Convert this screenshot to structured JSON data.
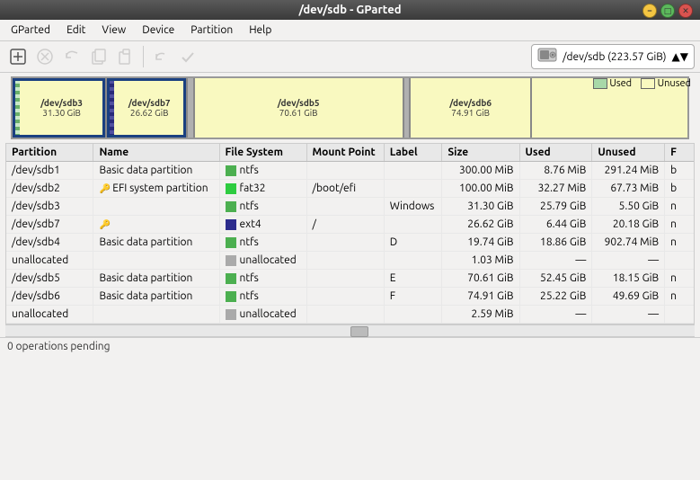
{
  "window": {
    "title": "/dev/sdb - GParted"
  },
  "menubar": {
    "items": [
      "GParted",
      "Edit",
      "View",
      "Device",
      "Partition",
      "Help"
    ]
  },
  "toolbar": {
    "buttons": [
      {
        "name": "new-partition",
        "icon": "➕",
        "disabled": false
      },
      {
        "name": "delete-partition",
        "icon": "🚫",
        "disabled": true
      },
      {
        "name": "resize-partition",
        "icon": "↔",
        "disabled": true
      },
      {
        "name": "copy-partition",
        "icon": "📋",
        "disabled": true
      },
      {
        "name": "paste-partition",
        "icon": "📄",
        "disabled": true
      },
      {
        "name": "undo",
        "icon": "↩",
        "disabled": true
      },
      {
        "name": "apply",
        "icon": "✔",
        "disabled": true
      }
    ],
    "device": {
      "icon": "💾",
      "label": "/dev/sdb  (223.57 GiB)"
    }
  },
  "disk_visual": {
    "partitions": [
      {
        "id": "sdb3",
        "label": "/dev/sdb3",
        "size": "31.30 GiB",
        "width_pct": 14,
        "color": "yellow-ntfs",
        "selected": false,
        "stripe": true
      },
      {
        "id": "sdb7",
        "label": "/dev/sdb7",
        "size": "26.62 GiB",
        "width_pct": 12,
        "color": "yellow-ext4",
        "selected": false,
        "stripe_dark": true
      },
      {
        "id": "gap1",
        "label": "",
        "size": "",
        "width_pct": 1,
        "color": "unalloc",
        "selected": false
      },
      {
        "id": "sdb5",
        "label": "/dev/sdb5",
        "size": "70.61 GiB",
        "width_pct": 32,
        "color": "yellow-ntfs",
        "selected": false,
        "stripe": false
      },
      {
        "id": "gap2",
        "label": "",
        "size": "",
        "width_pct": 1,
        "color": "unalloc",
        "selected": false
      },
      {
        "id": "sdb6",
        "label": "/dev/sdb6",
        "size": "74.91 GiB",
        "width_pct": 34,
        "color": "yellow-ntfs",
        "selected": false,
        "stripe": false
      },
      {
        "id": "gap3",
        "label": "",
        "size": "",
        "width_pct": 4,
        "color": "unalloc",
        "selected": false
      }
    ]
  },
  "table": {
    "columns": [
      "Partition",
      "Name",
      "File System",
      "Mount Point",
      "Label",
      "Size",
      "Used",
      "Unused",
      "Flags"
    ],
    "rows": [
      {
        "partition": "/dev/sdb1",
        "name": "Basic data partition",
        "fs": "ntfs",
        "fs_type": "ntfs",
        "mount": "",
        "label": "",
        "size": "300.00 MiB",
        "used": "8.76 MiB",
        "unused": "291.24 MiB",
        "flags": "b",
        "selected": false
      },
      {
        "partition": "/dev/sdb2",
        "name": "EFI system partition",
        "fs": "fat32",
        "fs_type": "fat32",
        "mount": "/boot/efi",
        "label": "",
        "size": "100.00 MiB",
        "used": "32.27 MiB",
        "unused": "67.73 MiB",
        "flags": "b",
        "selected": false
      },
      {
        "partition": "/dev/sdb3",
        "name": "",
        "fs": "ntfs",
        "fs_type": "ntfs",
        "mount": "",
        "label": "Windows",
        "size": "31.30 GiB",
        "used": "25.79 GiB",
        "unused": "5.50 GiB",
        "flags": "n",
        "selected": false
      },
      {
        "partition": "/dev/sdb7",
        "name": "",
        "fs": "ext4",
        "fs_type": "ext4",
        "mount": "/",
        "label": "",
        "size": "26.62 GiB",
        "used": "6.44 GiB",
        "unused": "20.18 GiB",
        "flags": "n",
        "selected": false
      },
      {
        "partition": "/dev/sdb4",
        "name": "Basic data partition",
        "fs": "ntfs",
        "fs_type": "ntfs",
        "mount": "",
        "label": "D",
        "size": "19.74 GiB",
        "used": "18.86 GiB",
        "unused": "902.74 MiB",
        "flags": "n",
        "selected": false
      },
      {
        "partition": "unallocated",
        "name": "",
        "fs": "unallocated",
        "fs_type": "unalloc",
        "mount": "",
        "label": "",
        "size": "1.03 MiB",
        "used": "—",
        "unused": "—",
        "flags": "",
        "selected": false
      },
      {
        "partition": "/dev/sdb5",
        "name": "Basic data partition",
        "fs": "ntfs",
        "fs_type": "ntfs",
        "mount": "",
        "label": "E",
        "size": "70.61 GiB",
        "used": "52.45 GiB",
        "unused": "18.15 GiB",
        "flags": "n",
        "selected": false
      },
      {
        "partition": "/dev/sdb6",
        "name": "Basic data partition",
        "fs": "ntfs",
        "fs_type": "ntfs",
        "mount": "",
        "label": "F",
        "size": "74.91 GiB",
        "used": "25.22 GiB",
        "unused": "49.69 GiB",
        "flags": "n",
        "selected": false
      },
      {
        "partition": "unallocated",
        "name": "",
        "fs": "unallocated",
        "fs_type": "unalloc",
        "mount": "",
        "label": "",
        "size": "2.59 MiB",
        "used": "—",
        "unused": "—",
        "flags": "",
        "selected": false
      }
    ]
  },
  "legend": {
    "used_label": "Used",
    "unused_label": "Unused"
  },
  "statusbar": {
    "text": "0 operations pending"
  }
}
